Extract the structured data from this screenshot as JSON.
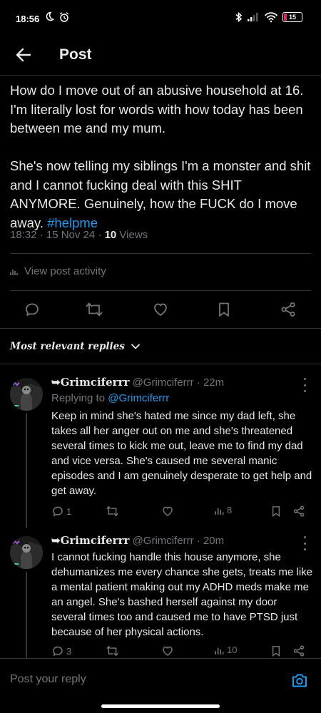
{
  "status_bar": {
    "time": "18:56",
    "battery": "15",
    "battery_level": 0.15,
    "battery_color": "#e0245e"
  },
  "header": {
    "title": "Post"
  },
  "post": {
    "text": "How do I move out of an abusive household at 16. I'm literally lost for words with how today has been between me and my mum.\n\nShe's now telling my siblings I'm a monster and shit and I cannot fucking deal with this SHIT ANYMORE. Genuinely, how the FUCK do I move away. ",
    "hashtag": "#helpme",
    "time": "18:32 · 15 Nov 24 · ",
    "views_count": "10",
    "views_label": " Views",
    "activity_label": "View post activity"
  },
  "actions": [
    "reply-icon",
    "repost-icon",
    "like-icon",
    "bookmark-icon",
    "share-icon"
  ],
  "sort": {
    "label": "Most relevant replies"
  },
  "replies": [
    {
      "name": "➥Grimciferrr",
      "handle": "@Grimciferrr",
      "time": "22m",
      "replying_prefix": "Replying to ",
      "replying_handle": "@Grimciferrr",
      "text": "Keep in mind she's hated me since my dad left, she takes all her anger out on me and she's threatened several times to kick me out, leave me to find my dad and vice versa. She's caused me several manic episodes and I am genuinely desperate to get help and get away.",
      "reply_count": "1",
      "views": "8"
    },
    {
      "name": "➥Grimciferrr",
      "handle": "@Grimciferrr",
      "time": "20m",
      "text": "I cannot fucking handle this house anymore, she dehumanizes me every chance she gets, treats me like a mental patient making out my ADHD meds make me an angel. She's bashed herself against my door several times too and caused me to have PTSD just because of her physical actions.",
      "reply_count": "3",
      "views": "10"
    }
  ],
  "compose": {
    "placeholder": "Post your reply"
  },
  "colors": {
    "accent": "#1d9bf0",
    "muted": "#71767b",
    "text": "#e7e9ea",
    "background": "#000000"
  }
}
